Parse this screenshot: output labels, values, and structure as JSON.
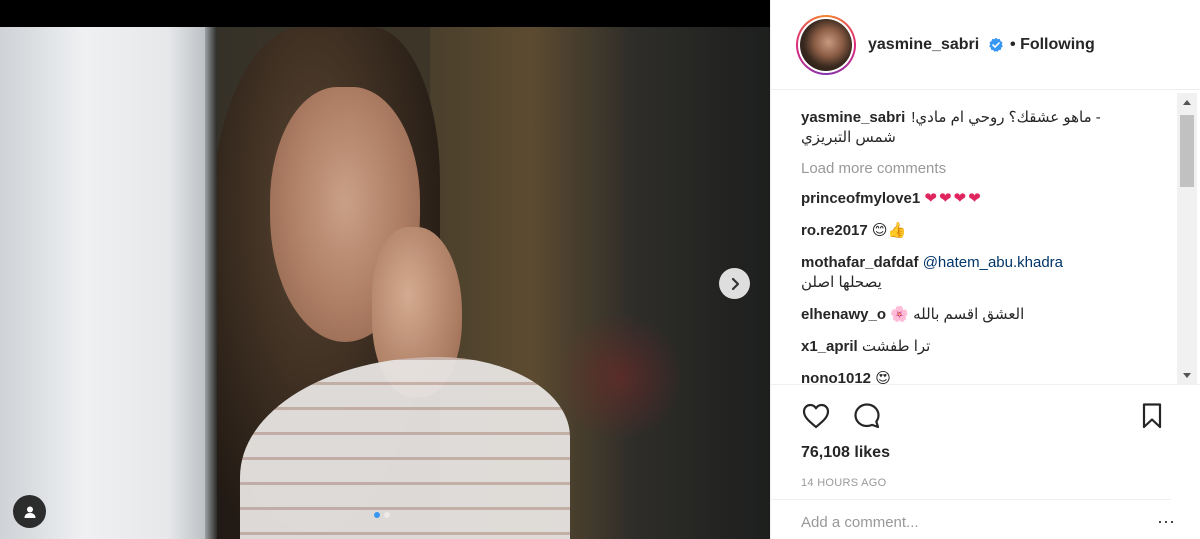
{
  "post": {
    "username": "yasmine_sabri",
    "follow_status": "Following",
    "separator": "•"
  },
  "caption": {
    "username": "yasmine_sabri",
    "text_line1": "- ماهو عشقك؟ روحي ام مادي!",
    "text_line2": "شمس التبريزي"
  },
  "load_more_label": "Load more comments",
  "comments": [
    {
      "user": "princeofmylove1",
      "text": "❤❤❤❤"
    },
    {
      "user": "ro.re2017",
      "text": "😊👍"
    },
    {
      "user": "mothafar_dafdaf",
      "mention": "@hatem_abu.khadra",
      "text": "يصحلها اصلن"
    },
    {
      "user": "elhenawy_o",
      "text": "العشق اقسم بالله 🌸"
    },
    {
      "user": "x1_april",
      "text": "ترا طفشت"
    },
    {
      "user": "nono1012",
      "text": "😍"
    }
  ],
  "likes": "76,108 likes",
  "timestamp": "14 HOURS AGO",
  "add_comment": {
    "placeholder": "Add a comment..."
  },
  "more_label": "···",
  "carousel": {
    "current": 1,
    "total": 2
  },
  "icons": {
    "like": "heart-icon",
    "comment": "comment-bubble-icon",
    "save": "bookmark-icon",
    "next": "chevron-right-icon",
    "tag": "person-tag-icon",
    "verified": "verified-badge-icon"
  },
  "colors": {
    "accent": "#3897f0",
    "verified": "#3897f0",
    "text": "#262626",
    "muted": "#999999"
  }
}
